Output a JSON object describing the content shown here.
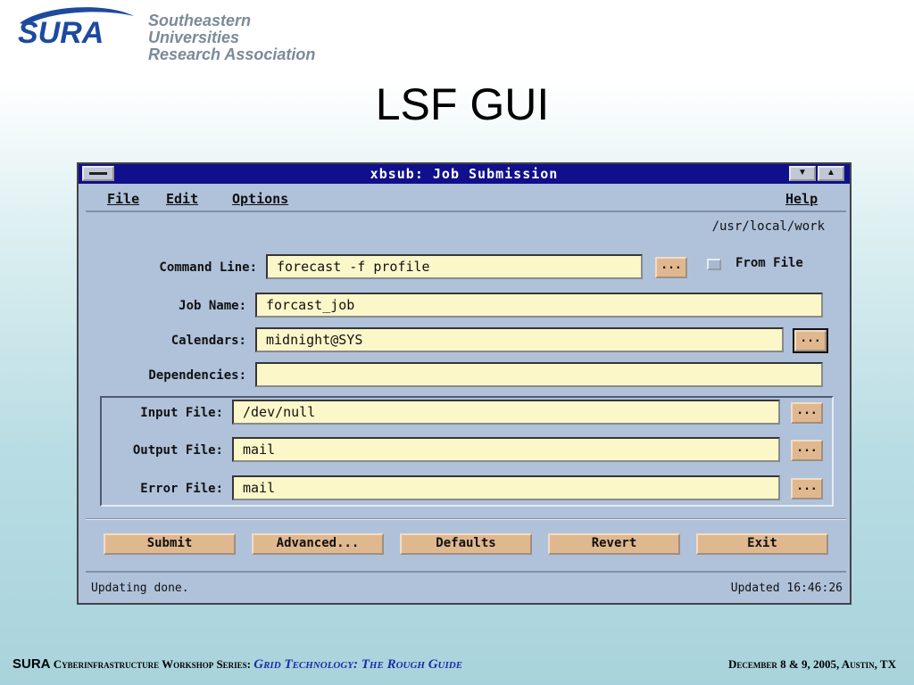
{
  "slide": {
    "logo": {
      "mark": "SURA",
      "line1": "Southeastern Universities",
      "line2": "Research Association"
    },
    "title": "LSF GUI",
    "footer": {
      "sura": "SURA",
      "series": "Cyberinfrastructure Workshop Series:",
      "guide": "Grid Technology: The Rough Guide",
      "date": "December 8 & 9, 2005, Austin, TX"
    }
  },
  "window": {
    "title": "xbsub: Job Submission",
    "menus": {
      "file": "File",
      "edit": "Edit",
      "options": "Options",
      "help": "Help"
    },
    "workdir": "/usr/local/work",
    "fields": {
      "command_line": {
        "label": "Command Line:",
        "value": "forecast -f profile"
      },
      "job_name": {
        "label": "Job Name:",
        "value": "forcast_job"
      },
      "calendars": {
        "label": "Calendars:",
        "value": "midnight@SYS"
      },
      "dependencies": {
        "label": "Dependencies:",
        "value": ""
      },
      "input_file": {
        "label": "Input File:",
        "value": "/dev/null"
      },
      "output_file": {
        "label": "Output File:",
        "value": "mail"
      },
      "error_file": {
        "label": "Error File:",
        "value": "mail"
      }
    },
    "browse_label": "...",
    "from_file_label": "From File",
    "buttons": {
      "submit": "Submit",
      "advanced": "Advanced...",
      "defaults": "Defaults",
      "revert": "Revert",
      "exit": "Exit"
    },
    "status": {
      "message": "Updating done.",
      "updated": "Updated 16:46:26"
    }
  },
  "colors": {
    "window_bg": "#b0c1da",
    "titlebar": "#10108c",
    "field_bg": "#fbf7c9",
    "button_bg": "#e0b890",
    "logo_blue": "#1d4aa0",
    "footer_link": "#1b2ca8"
  }
}
